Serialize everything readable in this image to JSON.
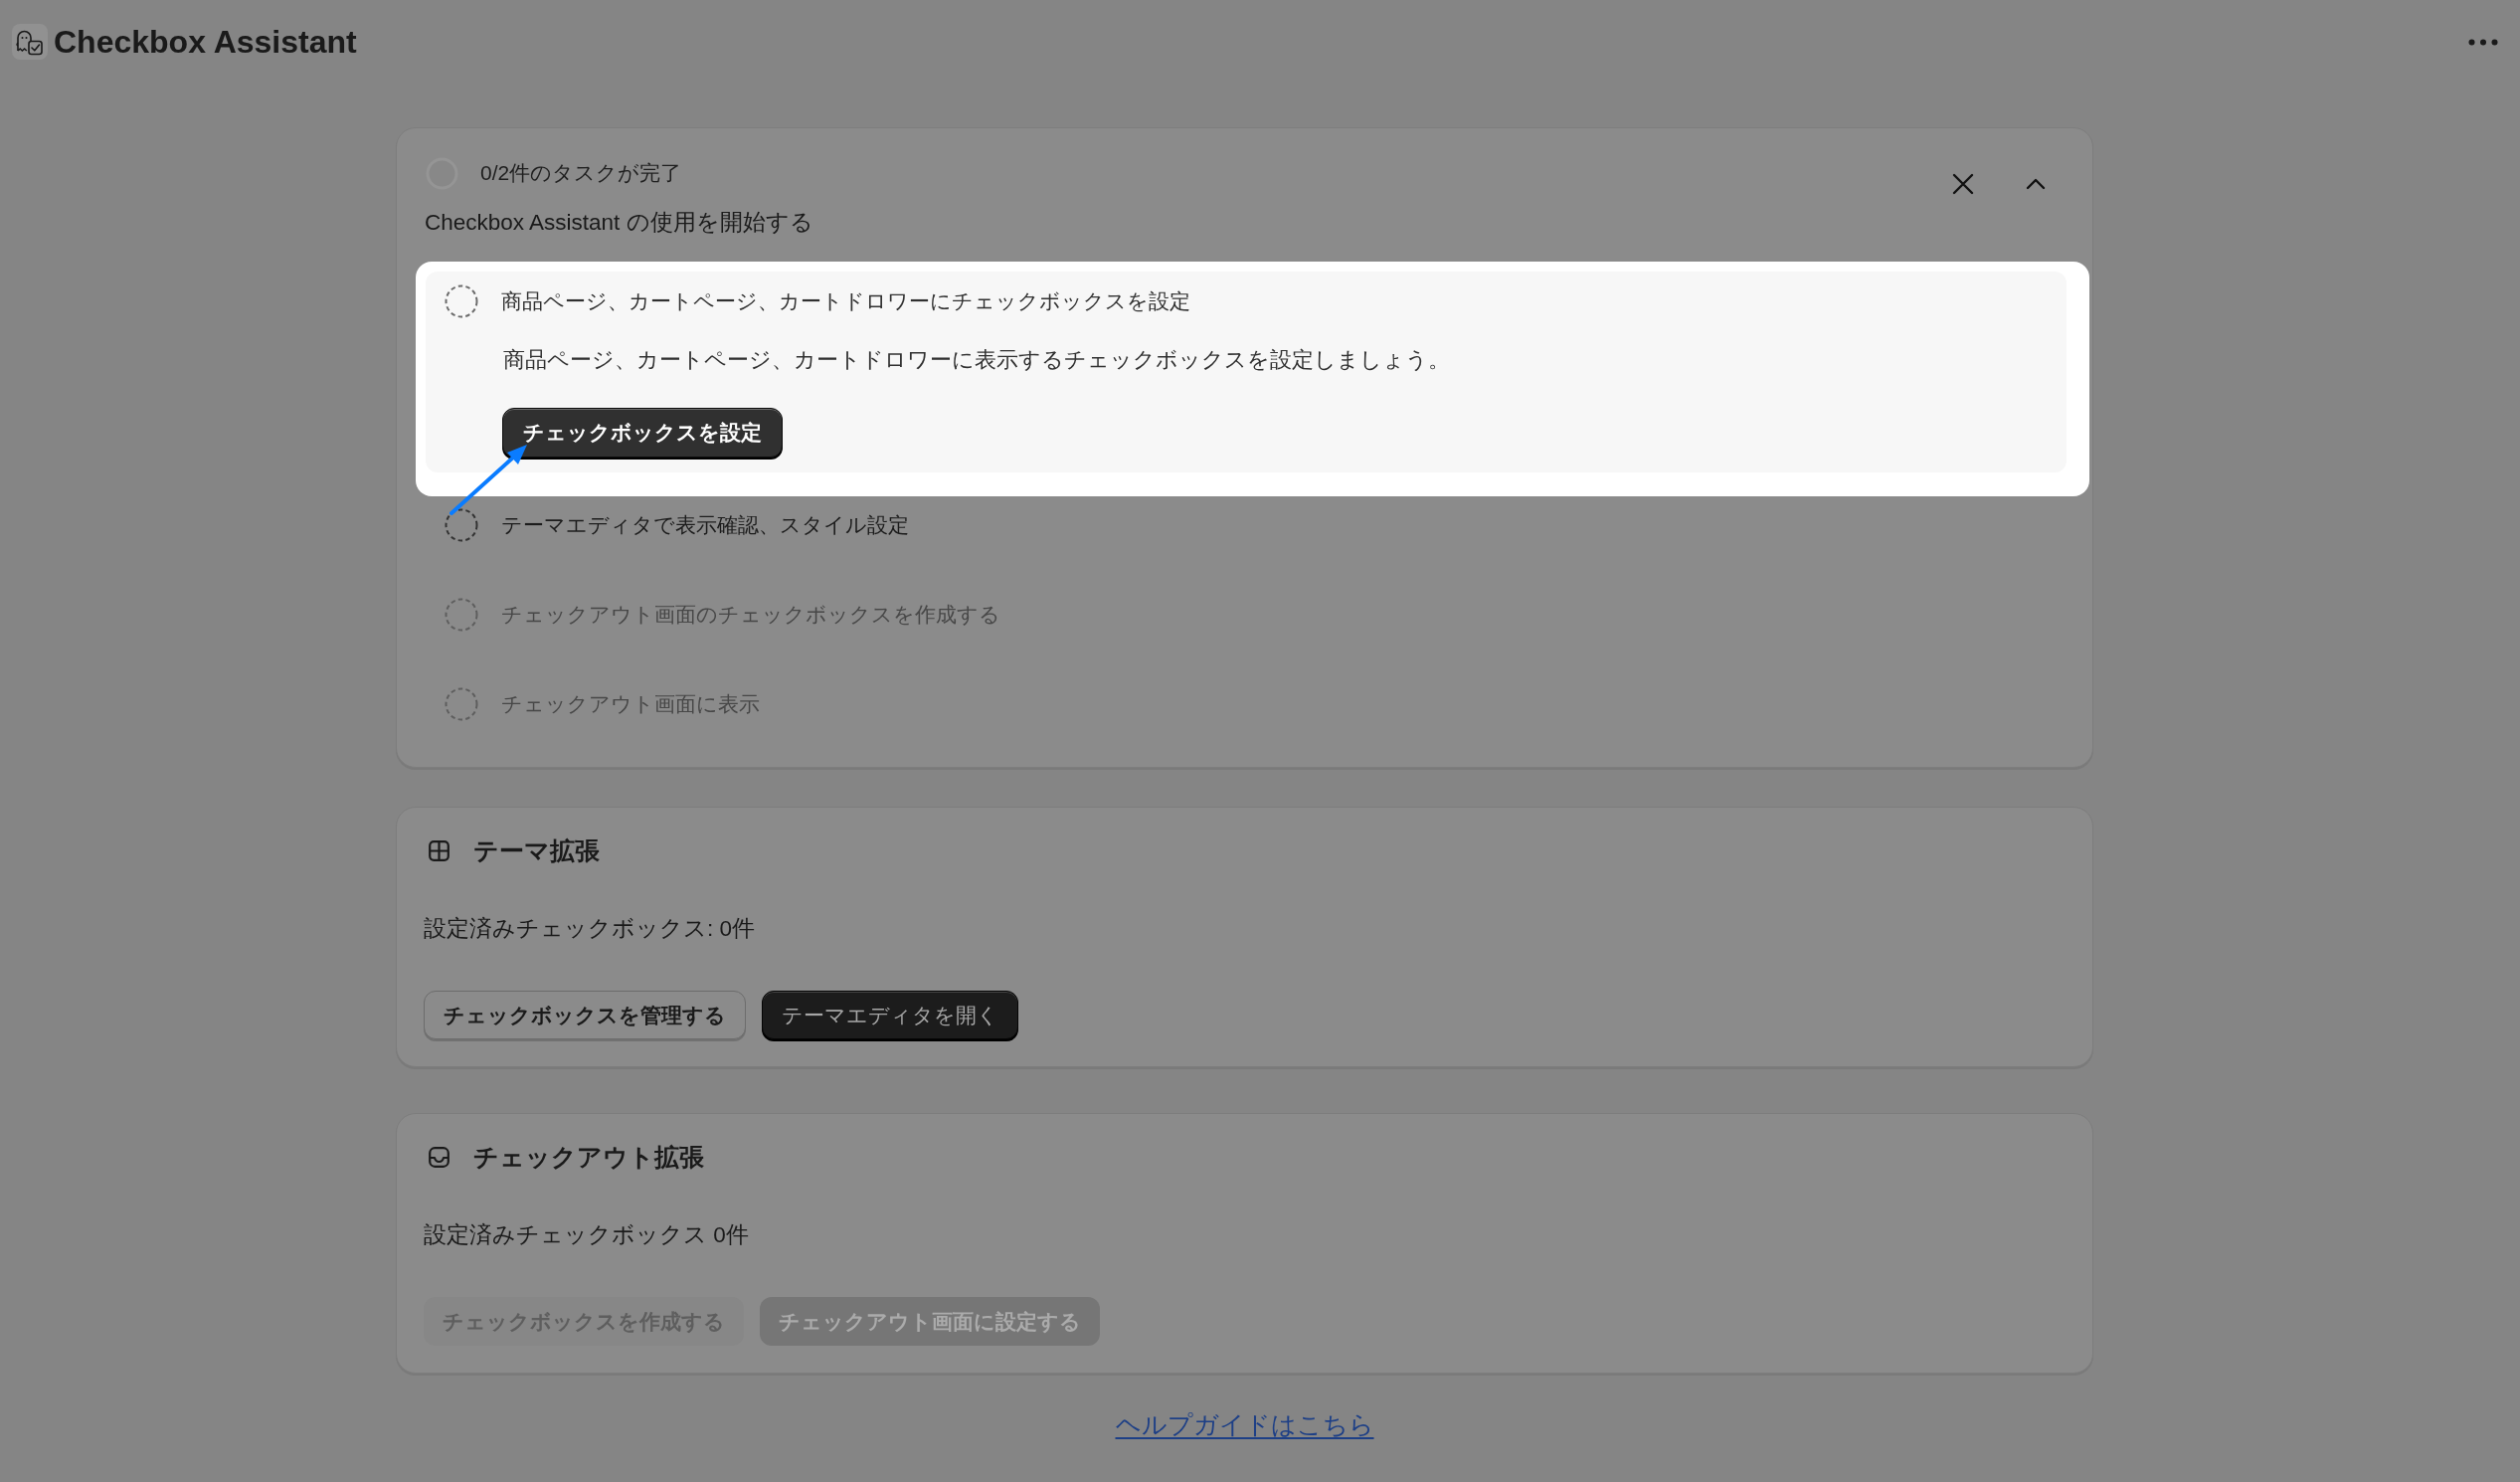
{
  "app": {
    "title": "Checkbox Assistant"
  },
  "onboarding": {
    "progress": "0/2件のタスクが完了",
    "title": "Checkbox Assistant の使用を開始する",
    "expanded": true,
    "tasks": [
      {
        "title": "商品ページ、カートページ、カートドロワーにチェックボックスを設定",
        "completed": false,
        "disabled": false,
        "expanded": true,
        "highlighted": true,
        "description": "商品ページ、カートページ、カートドロワーに表示するチェックボックスを設定しましょう。",
        "button": "チェックボックスを設定"
      },
      {
        "title": "テーマエディタで表示確認、スタイル設定",
        "completed": false,
        "disabled": false,
        "expanded": false,
        "highlighted": false
      },
      {
        "title": "チェックアウト画面のチェックボックスを作成する",
        "completed": false,
        "disabled": true,
        "expanded": false,
        "highlighted": false
      },
      {
        "title": "チェックアウト画面に表示",
        "completed": false,
        "disabled": true,
        "expanded": false,
        "highlighted": false
      }
    ]
  },
  "sections": [
    {
      "kind": "theme",
      "title": "テーマ拡張",
      "status": "設定済みチェックボックス: 0件",
      "buttons": [
        {
          "label": "チェックボックスを管理する",
          "disabled": false
        },
        {
          "label": "テーマエディタを開く",
          "disabled": false
        }
      ]
    },
    {
      "kind": "checkout",
      "title": "チェックアウト拡張",
      "status": "設定済みチェックボックス 0件",
      "buttons": [
        {
          "label": "チェックボックスを作成する",
          "disabled": true
        },
        {
          "label": "チェックアウト画面に設定する",
          "disabled": true
        }
      ]
    }
  ],
  "help_link": "ヘルプガイドはこちら"
}
